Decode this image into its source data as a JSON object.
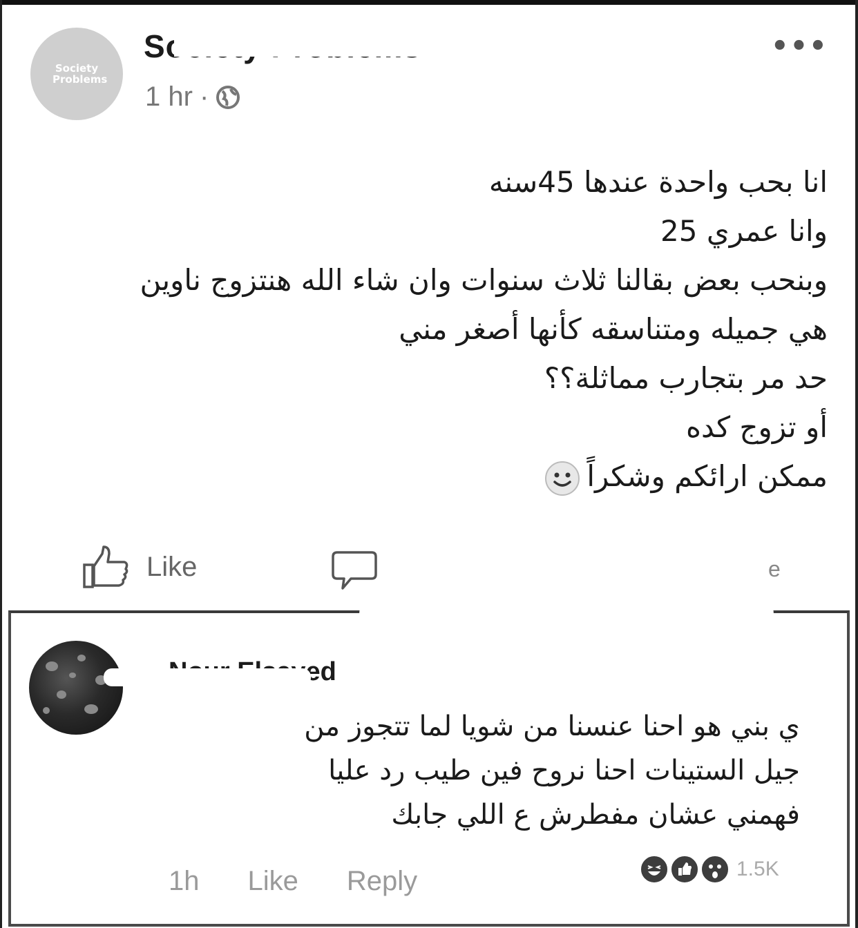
{
  "post": {
    "page_name": "Society Problems",
    "page_avatar_text": "Society Problems",
    "time": "1 hr",
    "separator": "·",
    "more_label": "•••",
    "body_lines": [
      "انا بحب واحدة عندها 45سنه",
      "وانا عمري 25",
      "وبنحب بعض بقالنا ثلاث سنوات وان شاء الله هنتزوج ناوين",
      "هي جميله ومتناسقه كأنها أصغر مني",
      "حد مر بتجارب مماثلة؟؟",
      "أو تزوج كده",
      "ممكن ارائكم وشكراً"
    ],
    "like_label": "Like",
    "share_stub": "e"
  },
  "comment": {
    "author": "Nour Elsayed",
    "lines": [
      "ي بني هو احنا عنسنا من شويا لما تتجوز من",
      "جيل الستينات احنا نروح فين طيب رد عليا",
      "فهمني عشان مفطرش ع اللي جابك"
    ],
    "time": "1h",
    "like_label": "Like",
    "reply_label": "Reply",
    "reaction_count": "1.5K"
  }
}
